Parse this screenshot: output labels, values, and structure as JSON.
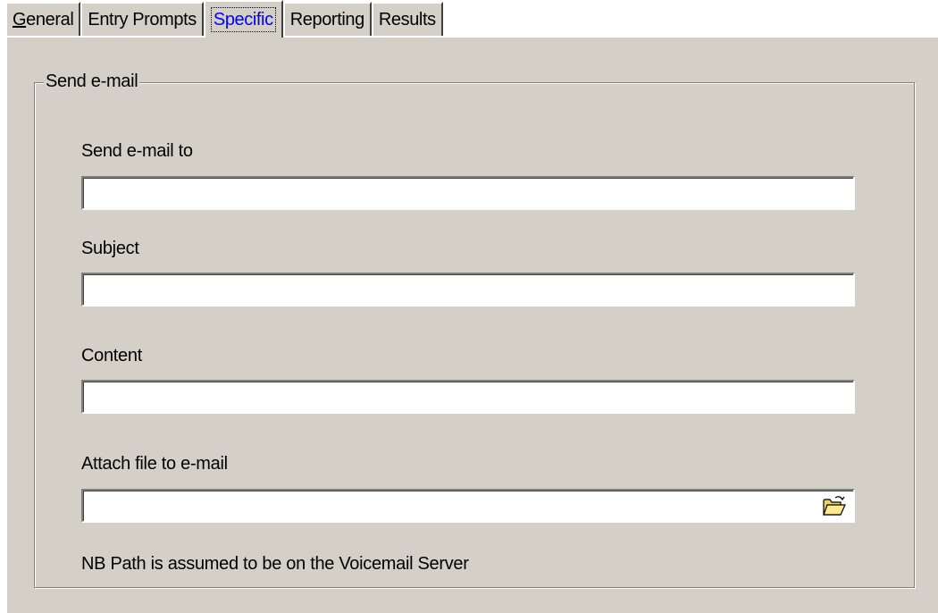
{
  "tabs": [
    {
      "accel": "G",
      "rest": "eneral"
    },
    {
      "label": "Entry Prompts"
    },
    {
      "label": "Specific"
    },
    {
      "label": "Reporting"
    },
    {
      "label": "Results"
    }
  ],
  "group": {
    "title": "Send e-mail"
  },
  "fields": {
    "send_to": {
      "label": "Send e-mail to",
      "value": ""
    },
    "subject": {
      "label": "Subject",
      "value": ""
    },
    "content": {
      "label": "Content",
      "value": ""
    },
    "attach": {
      "label": "Attach file to e-mail",
      "value": "",
      "icon": "folder-open-icon"
    }
  },
  "note": "NB Path is assumed to be on the Voicemail Server",
  "colors": {
    "face": "#d4d0c8",
    "active_tab_text": "#0000ff"
  }
}
